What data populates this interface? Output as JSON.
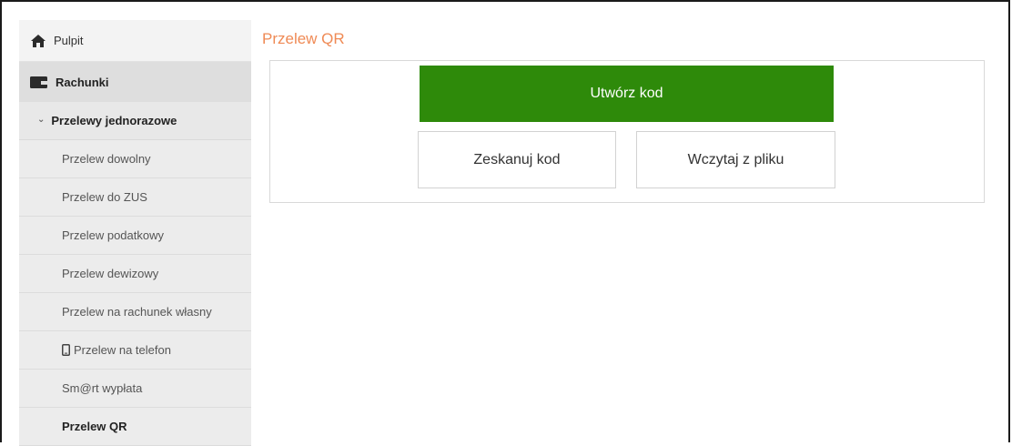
{
  "page": {
    "title": "Przelew QR"
  },
  "sidebar": {
    "items": [
      {
        "label": "Pulpit",
        "icon": "home-icon"
      },
      {
        "label": "Rachunki",
        "icon": "wallet-icon"
      },
      {
        "label": "Przelewy jednorazowe",
        "icon": "chevron-down-icon"
      },
      {
        "label": "Przelew dowolny"
      },
      {
        "label": "Przelew do ZUS"
      },
      {
        "label": "Przelew podatkowy"
      },
      {
        "label": "Przelew dewizowy"
      },
      {
        "label": "Przelew na rachunek własny"
      },
      {
        "label": "Przelew na telefon",
        "icon": "phone-icon"
      },
      {
        "label": "Sm@rt wypłata"
      },
      {
        "label": "Przelew QR",
        "active": true
      }
    ]
  },
  "actions": {
    "create_code": "Utwórz kod",
    "scan_code": "Zeskanuj kod",
    "load_file": "Wczytaj z pliku"
  },
  "colors": {
    "accent_title": "#ef8a55",
    "primary_button": "#2e8a0a",
    "sidebar_bg": "#ececec"
  }
}
